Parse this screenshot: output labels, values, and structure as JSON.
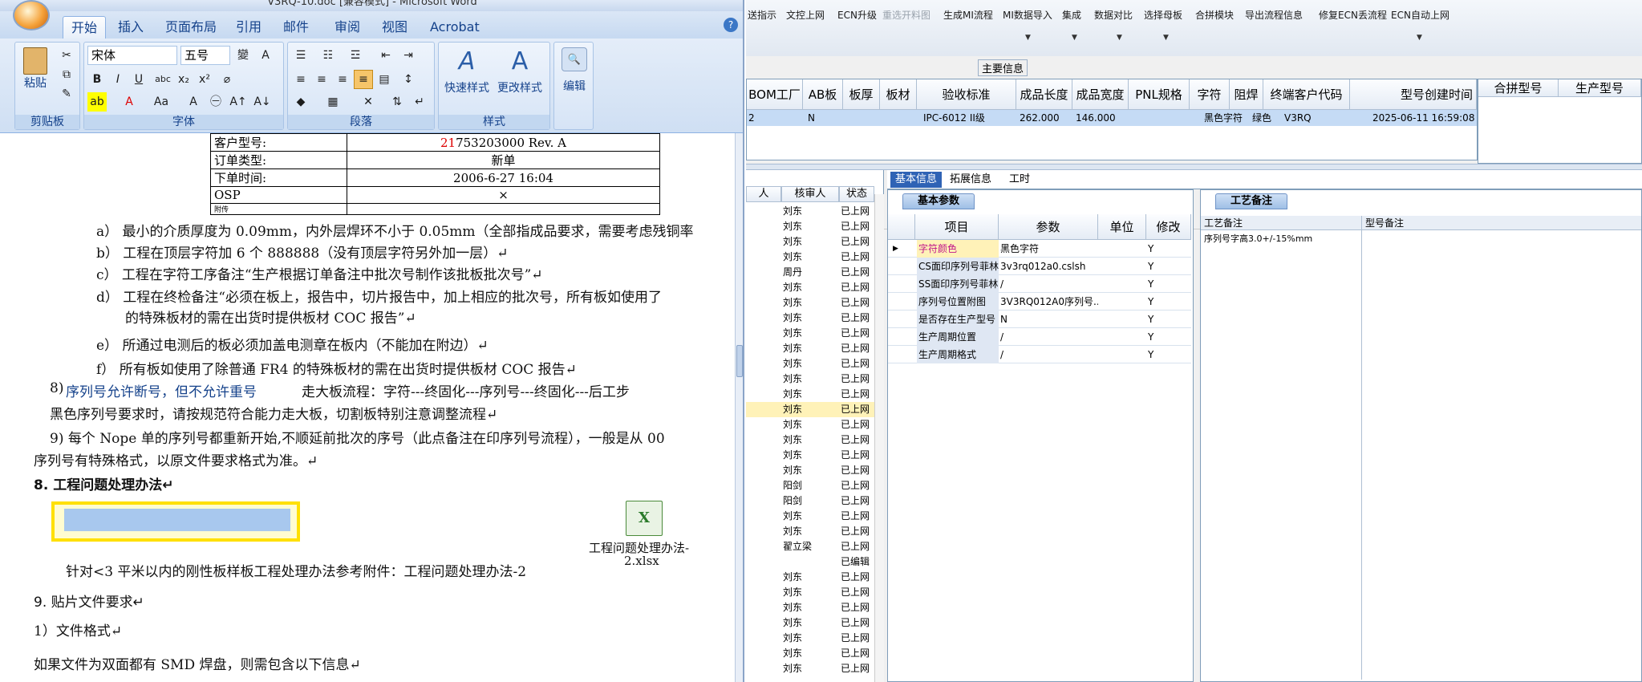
{
  "word": {
    "title": "V3RQ-10.doc [兼容模式] - Microsoft Word",
    "tabs": [
      "开始",
      "插入",
      "页面布局",
      "引用",
      "邮件",
      "审阅",
      "视图",
      "Acrobat"
    ],
    "groups": {
      "clipboard": {
        "label": "剪贴板",
        "paste": "粘贴"
      },
      "font": {
        "label": "字体",
        "font_name": "宋体",
        "font_size": "五号"
      },
      "paragraph": {
        "label": "段落"
      },
      "styles": {
        "label": "样式",
        "quick": "快速样式",
        "change": "更改样式"
      },
      "editing": {
        "label": "编辑",
        "name": "编辑"
      }
    },
    "order_table": [
      {
        "k": "客户型号:",
        "v_red": "21",
        "v": "753203000 Rev. A"
      },
      {
        "k": "订单类型:",
        "v": "新单"
      },
      {
        "k": "下单时间:",
        "v": "2006-6-27 16:04"
      },
      {
        "k": "OSP",
        "v": "×"
      },
      {
        "k": "附传",
        "v": ""
      }
    ],
    "lines": {
      "a": "a）  最小的介质厚度为 0.09mm，内外层焊环不小于 0.05mm（全部指成品要求，需要考虑残铜率",
      "b": "b）  工程在顶层字符加 6 个 888888（没有顶层字符另外加一层）↵",
      "c": "c）  工程在字符工序备注“生产根据订单备注中批次号制作该批板批次号”↵",
      "d1": "d）  工程在终检备注“必须在板上，报告中，切片报告中，加上相应的批次号，所有板如使用了",
      "d2": "的特殊板材的需在出货时提供板材 COC 报告”↵",
      "e": "e）  所通过电测后的板必须加盖电测章在板内（不能加在附边）↵",
      "f": "f）  所有板如使用了除普通 FR4 的特殊板材的需在出货时提供板材 COC 报告↵",
      "s8_selected": "序列号允许断号，但不允许重号",
      "s8_prefix": "8)",
      "s8_rest": "走大板流程：字符---终固化---序列号---终固化---后工步",
      "s8b": "黑色序列号要求时，请按规范符合能力走大板，切割板特别注意调整流程↵",
      "s9": "9) 每个 Nope 单的序列号都重新开始,不顺延前批次的序号（此点备注在印序列号流程），一般是从 00",
      "s9b": "序列号有特殊格式，以原文件要求格式为准。↵",
      "h8": "8.  工程问题处理办法↵",
      "attach_name1": "工程问题处理办法-",
      "attach_name2": "2.xlsx",
      "attach_line": "针对<3 平米以内的刚性板样板工程处理办法参考附件：工程问题处理办法-2",
      "h9": "9. 贴片文件要求↵",
      "p1": "1）文件格式↵",
      "p2": "如果文件为双面都有 SMD 焊盘，则需包含以下信息↵"
    }
  },
  "app": {
    "toolbar": [
      {
        "label": "送指示",
        "dis": false
      },
      {
        "label": "文控上网",
        "dis": false
      },
      {
        "label": "ECN升级",
        "dis": false
      },
      {
        "label": "重选开料图",
        "dis": true
      },
      {
        "label": "生成MI流程",
        "dis": false
      },
      {
        "label": "MI数据导入",
        "dis": false
      },
      {
        "label": "集成",
        "dis": false
      },
      {
        "label": "数据对比",
        "dis": false
      },
      {
        "label": "选择母板",
        "dis": false
      },
      {
        "label": "合拼模块",
        "dis": false
      },
      {
        "label": "导出流程信息",
        "dis": false
      },
      {
        "label": "修复ECN丢流程",
        "dis": false
      },
      {
        "label": "ECN自动上网",
        "dis": false
      }
    ],
    "main_info_label": "主要信息",
    "top_grid": {
      "headers": [
        "BOM工厂",
        "AB板",
        "板厚",
        "板材",
        "验收标准",
        "成品长度",
        "成品宽度",
        "PNL规格",
        "字符",
        "阻焊",
        "终端客户代码",
        "型号创建时间"
      ],
      "row": [
        "2",
        "N",
        "",
        "",
        "IPC-6012 II级",
        "262.000",
        "146.000",
        "",
        "黑色字符",
        "绿色",
        "V3RQ",
        "2025-06-11 16:59:08"
      ]
    },
    "merge_grid": {
      "headers": [
        "合拼型号",
        "生产型号"
      ]
    },
    "left_list": {
      "headers": [
        "人",
        "核审人",
        "状态"
      ],
      "rows": [
        [
          "刘东",
          "已上网"
        ],
        [
          "刘东",
          "已上网"
        ],
        [
          "刘东",
          "已上网"
        ],
        [
          "刘东",
          "已上网"
        ],
        [
          "周丹",
          "已上网"
        ],
        [
          "刘东",
          "已上网"
        ],
        [
          "刘东",
          "已上网"
        ],
        [
          "刘东",
          "已上网"
        ],
        [
          "刘东",
          "已上网"
        ],
        [
          "刘东",
          "已上网"
        ],
        [
          "刘东",
          "已上网"
        ],
        [
          "刘东",
          "已上网"
        ],
        [
          "刘东",
          "已上网"
        ],
        [
          "刘东",
          "已上网"
        ],
        [
          "刘东",
          "已上网"
        ],
        [
          "刘东",
          "已上网"
        ],
        [
          "刘东",
          "已上网"
        ],
        [
          "刘东",
          "已上网"
        ],
        [
          "阳剑",
          "已上网"
        ],
        [
          "阳剑",
          "已上网"
        ],
        [
          "刘东",
          "已上网"
        ],
        [
          "刘东",
          "已上网"
        ],
        [
          "翟立梁",
          "已上网"
        ],
        [
          "",
          "已编辑"
        ],
        [
          "刘东",
          "已上网"
        ],
        [
          "刘东",
          "已上网"
        ],
        [
          "刘东",
          "已上网"
        ],
        [
          "刘东",
          "已上网"
        ],
        [
          "刘东",
          "已上网"
        ],
        [
          "刘东",
          "已上网"
        ],
        [
          "刘东",
          "已上网"
        ]
      ],
      "highlight_index": 13
    },
    "tabs": [
      "基本信息",
      "拓展信息",
      "工时"
    ],
    "params": {
      "title": "基本参数",
      "headers": [
        "项目",
        "参数",
        "单位",
        "修改"
      ],
      "rows": [
        [
          "字符颜色",
          "黑色字符",
          "",
          "Y"
        ],
        [
          "CS面印序列号菲林",
          "3v3rq012a0.cslsh",
          "",
          "Y"
        ],
        [
          "SS面印序列号菲林",
          "/",
          "",
          "Y"
        ],
        [
          "序列号位置附图",
          "3V3RQ012A0序列号...",
          "",
          "Y"
        ],
        [
          "是否存在生产型号",
          "N",
          "",
          "Y"
        ],
        [
          "生产周期位置",
          "/",
          "",
          "Y"
        ],
        [
          "生产周期格式",
          "/",
          "",
          "Y"
        ]
      ]
    },
    "craft": {
      "title": "工艺备注",
      "col1": "工艺备注",
      "col2": "型号备注",
      "note": "序列号字高3.0+/-15%mm"
    }
  }
}
